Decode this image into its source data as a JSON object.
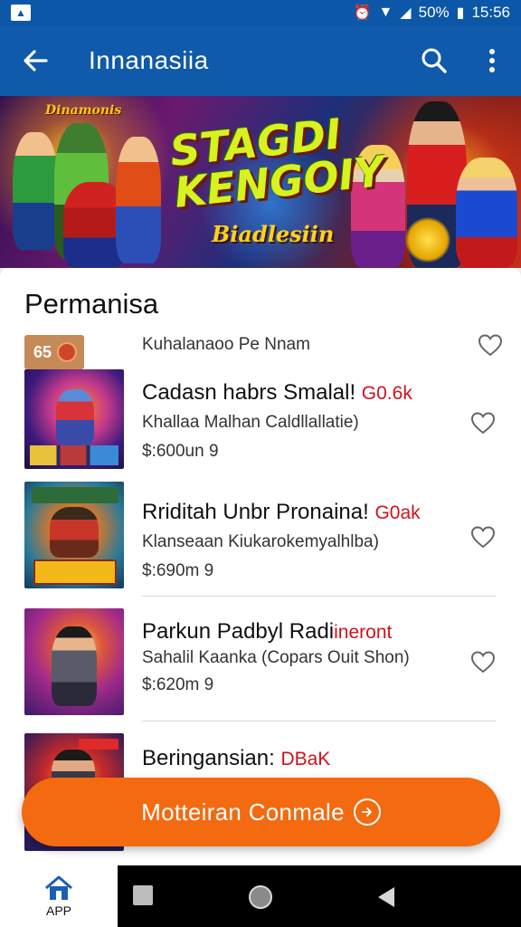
{
  "status_bar": {
    "battery": "50%",
    "time": "15:56"
  },
  "app_bar": {
    "title": "Innanasiia"
  },
  "banner": {
    "logo_line1": "STAGDI",
    "logo_line2": "KENGOIY",
    "tagline": "Biadlesiin",
    "mini_logo": "Dinamonis"
  },
  "section": {
    "title": "Permanisa"
  },
  "first_row": {
    "badge": "65",
    "subtitle": "Kuhalanaoo Pe Nnam"
  },
  "items": [
    {
      "name": "Cadasn habrs Smalal! ",
      "highlight": "G0.6k",
      "desc": "Khallaa Malhan Caldllallatie)",
      "price": "$:600un 9"
    },
    {
      "name": "Rriditah Unbr Pronaina! ",
      "highlight": "G0ak",
      "desc": "Klanseaan Kiukarokemyalhlba)",
      "price": "$:690m 9"
    },
    {
      "name": "Parkun Padbyl Radi",
      "highlight": "ineront",
      "desc": "Sahalil Kaanka (Copars Ouit Shon)",
      "price": "$:620m 9"
    },
    {
      "name": "Beringansian: ",
      "highlight": "DBaK",
      "desc": "",
      "price": ""
    }
  ],
  "cta": {
    "label": "Motteiran Conmale"
  },
  "bottom_nav": {
    "home_label": "APP"
  },
  "colors": {
    "primary": "#0f5aaa",
    "accent": "#f36a10",
    "highlight": "#d1121a"
  }
}
